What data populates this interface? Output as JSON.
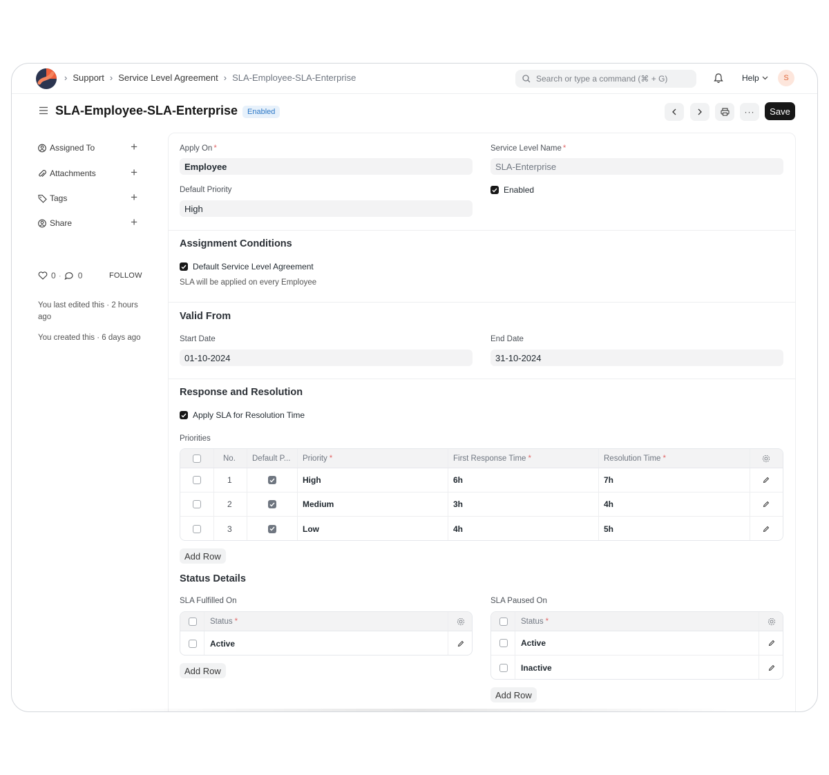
{
  "breadcrumb": {
    "items": [
      "Support",
      "Service Level Agreement"
    ],
    "current": "SLA-Employee-SLA-Enterprise"
  },
  "search": {
    "placeholder": "Search or type a command (⌘ + G)"
  },
  "navbar": {
    "help_label": "Help",
    "avatar_initial": "S"
  },
  "header": {
    "title": "SLA-Employee-SLA-Enterprise",
    "status": "Enabled",
    "save_label": "Save"
  },
  "sidebar": {
    "items": [
      {
        "label": "Assigned To",
        "icon": "user-assign-icon"
      },
      {
        "label": "Attachments",
        "icon": "paperclip-icon"
      },
      {
        "label": "Tags",
        "icon": "tag-icon"
      },
      {
        "label": "Share",
        "icon": "share-user-icon"
      }
    ],
    "likes": "0",
    "comments": "0",
    "follow_label": "FOLLOW",
    "last_edited": "You last edited this · 2 hours ago",
    "created": "You created this · 6 days ago"
  },
  "form": {
    "apply_on": {
      "label": "Apply On",
      "value": "Employee"
    },
    "service_level_name": {
      "label": "Service Level Name",
      "value": "SLA-Enterprise"
    },
    "default_priority": {
      "label": "Default Priority",
      "value": "High"
    },
    "enabled": {
      "label": "Enabled",
      "checked": true
    },
    "assignment": {
      "title": "Assignment Conditions",
      "default_sla_label": "Default Service Level Agreement",
      "default_sla_checked": true,
      "note": "SLA will be applied on every Employee"
    },
    "valid_from": {
      "title": "Valid From",
      "start_label": "Start Date",
      "start_value": "01-10-2024",
      "end_label": "End Date",
      "end_value": "31-10-2024"
    },
    "response": {
      "title": "Response and Resolution",
      "apply_resolution_label": "Apply SLA for Resolution Time",
      "apply_resolution_checked": true,
      "priorities_label": "Priorities",
      "columns": [
        "No.",
        "Default P...",
        "Priority",
        "First Response Time",
        "Resolution Time"
      ],
      "rows": [
        {
          "no": "1",
          "default": true,
          "priority": "High",
          "first_response": "6h",
          "resolution": "7h"
        },
        {
          "no": "2",
          "default": true,
          "priority": "Medium",
          "first_response": "3h",
          "resolution": "4h"
        },
        {
          "no": "3",
          "default": true,
          "priority": "Low",
          "first_response": "4h",
          "resolution": "5h"
        }
      ],
      "add_row_label": "Add Row"
    },
    "status_details": {
      "title": "Status Details",
      "fulfilled_label": "SLA Fulfilled On",
      "fulfilled_column": "Status",
      "fulfilled_rows": [
        "Active"
      ],
      "paused_label": "SLA Paused On",
      "paused_column": "Status",
      "paused_rows": [
        "Active",
        "Inactive"
      ],
      "add_row_label": "Add Row"
    }
  }
}
